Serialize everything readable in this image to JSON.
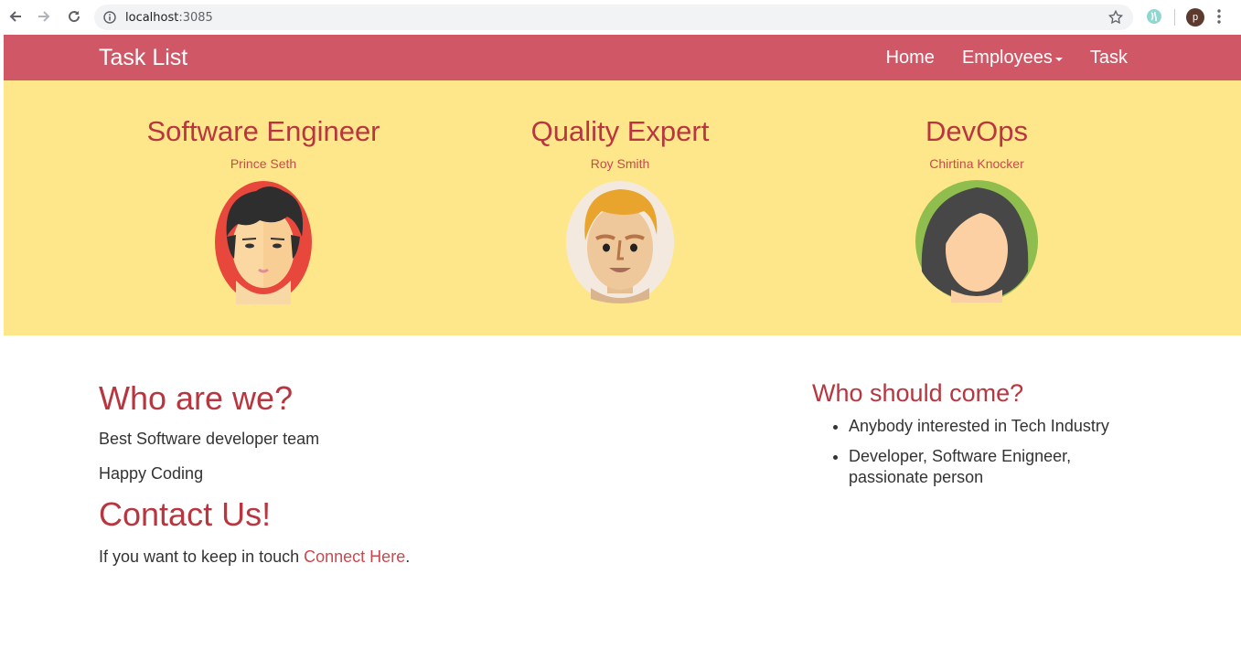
{
  "browser": {
    "url_host": "localhost",
    "url_port": ":3085",
    "profile_initial": "p"
  },
  "navbar": {
    "brand": "Task List",
    "links": [
      {
        "label": "Home"
      },
      {
        "label": "Employees"
      },
      {
        "label": "Task"
      }
    ]
  },
  "hero": {
    "members": [
      {
        "role": "Software Engineer",
        "name": "Prince Seth",
        "icon": "male-developer-avatar"
      },
      {
        "role": "Quality Expert",
        "name": "Roy Smith",
        "icon": "blond-man-avatar"
      },
      {
        "role": "DevOps",
        "name": "Chirtina Knocker",
        "icon": "woman-avatar"
      }
    ]
  },
  "about": {
    "heading": "Who are we?",
    "line1": "Best Software developer team",
    "line2": "Happy Coding"
  },
  "contact": {
    "heading": "Contact Us!",
    "text": "If you want to keep in touch ",
    "link": "Connect Here",
    "end": "."
  },
  "audience": {
    "heading": "Who should come?",
    "items": [
      "Anybody interested in Tech Industry",
      "Developer, Software Enigneer, passionate person"
    ]
  },
  "colors": {
    "navbar": "#d05766",
    "hero": "#fee78b",
    "heading": "#b8363f"
  }
}
